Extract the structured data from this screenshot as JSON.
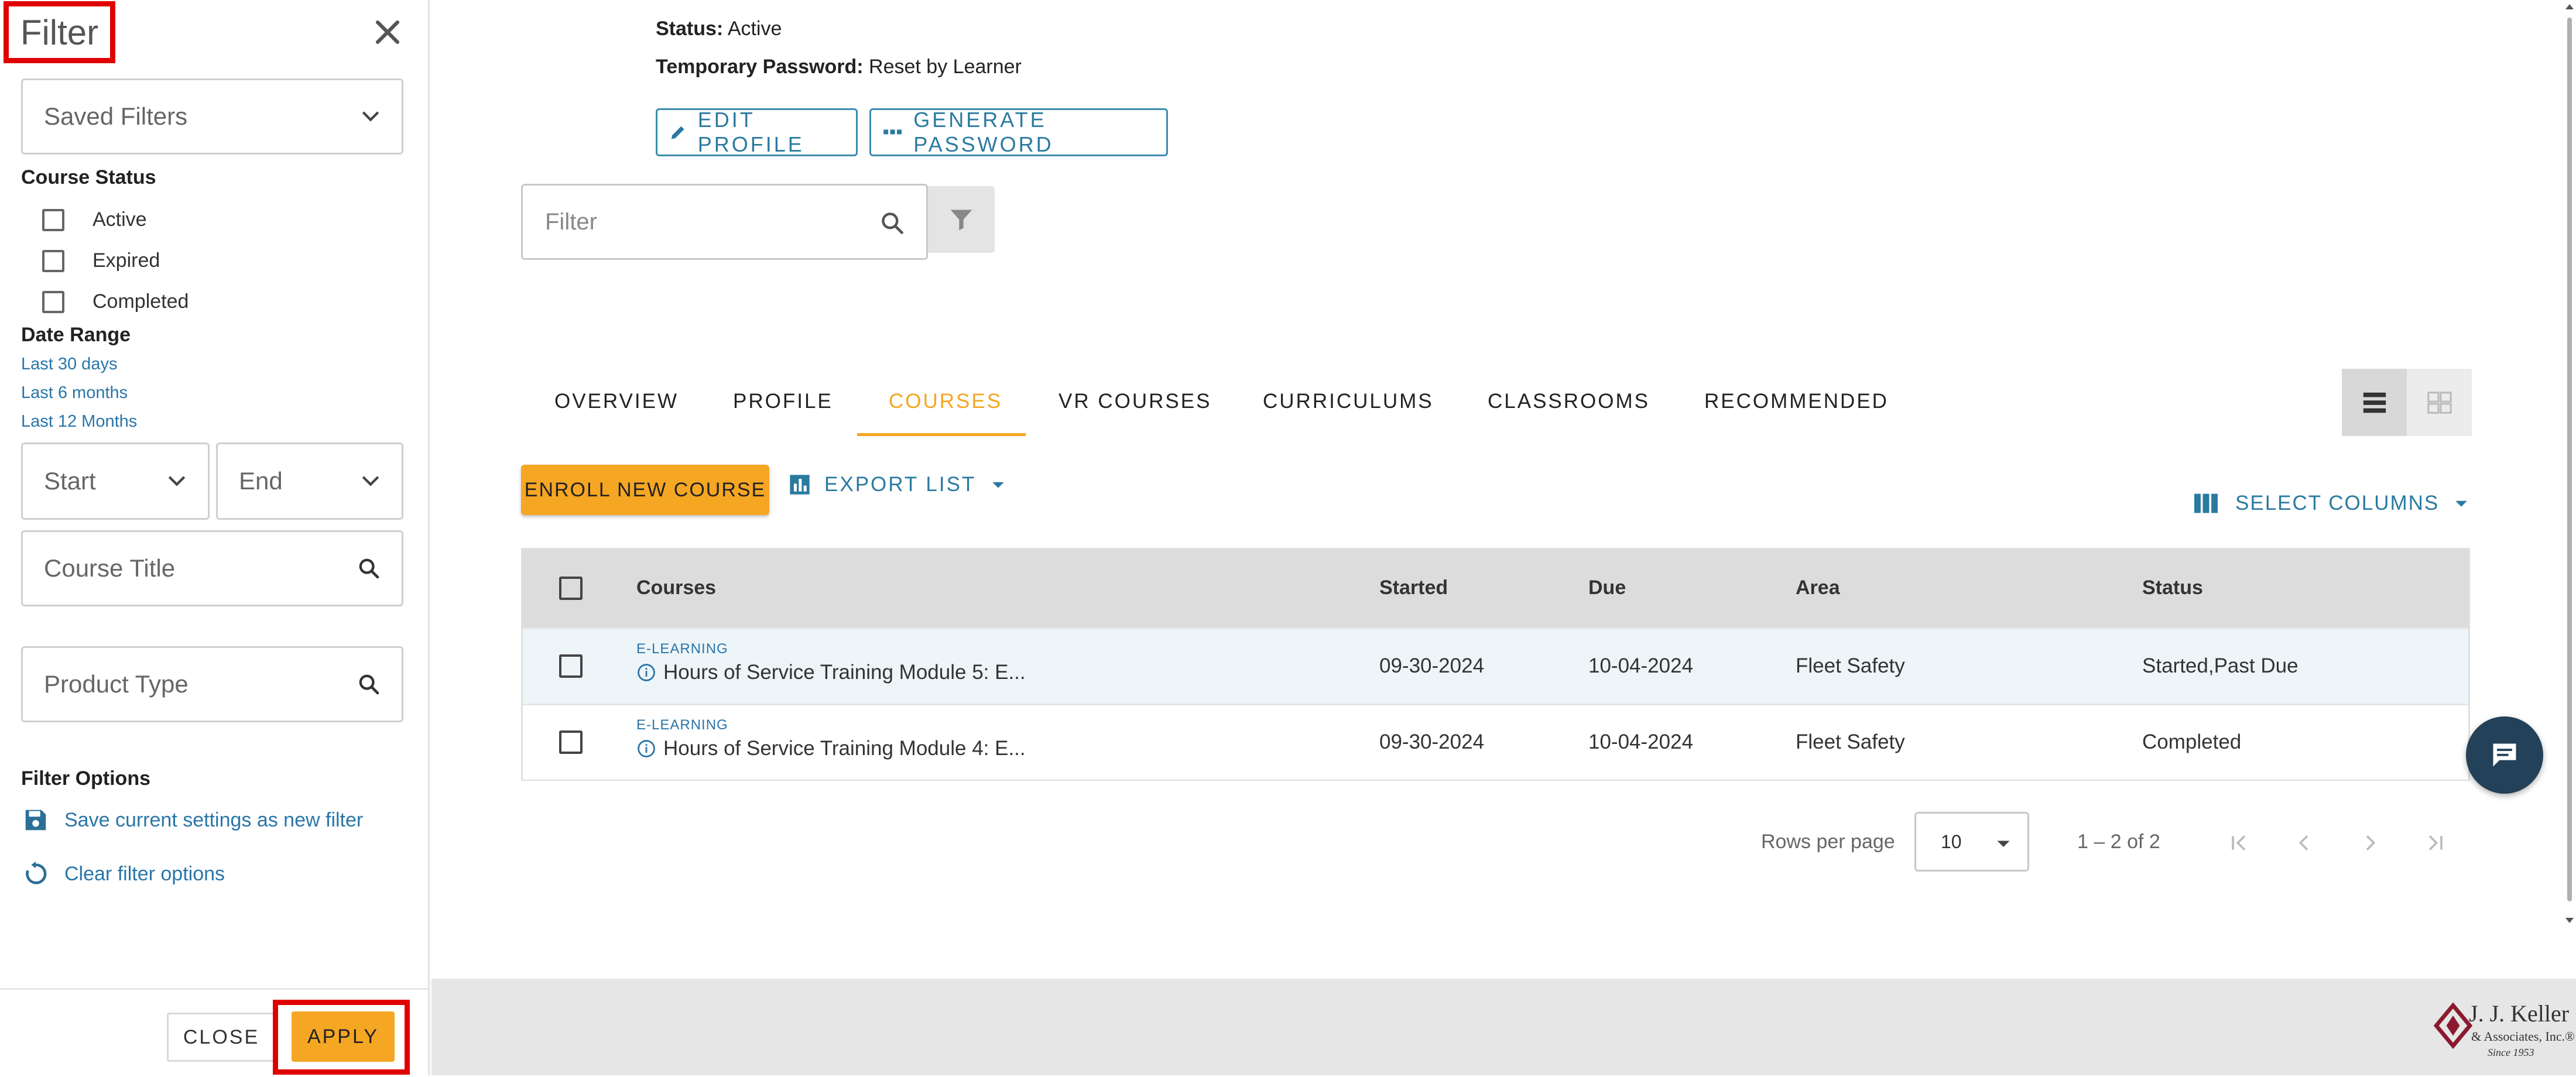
{
  "filter_panel": {
    "title": "Filter",
    "saved_filters_placeholder": "Saved Filters",
    "course_status_label": "Course Status",
    "statuses": [
      "Active",
      "Expired",
      "Completed"
    ],
    "date_range_label": "Date Range",
    "date_presets": [
      "Last 30 days",
      "Last 6 months",
      "Last 12 Months"
    ],
    "start_placeholder": "Start",
    "end_placeholder": "End",
    "course_title_placeholder": "Course Title",
    "product_type_placeholder": "Product Type",
    "filter_options_label": "Filter Options",
    "save_filter_label": "Save current settings as new filter",
    "clear_filter_label": "Clear filter options",
    "close_label": "CLOSE",
    "apply_label": "APPLY"
  },
  "profile": {
    "status_label": "Status:",
    "status_value": "Active",
    "temp_password_label": "Temporary Password:",
    "temp_password_value": "Reset by Learner",
    "edit_profile_label": "EDIT PROFILE",
    "generate_password_label": "GENERATE PASSWORD"
  },
  "search": {
    "placeholder": "Filter"
  },
  "tabs": [
    "OVERVIEW",
    "PROFILE",
    "COURSES",
    "VR COURSES",
    "CURRICULUMS",
    "CLASSROOMS",
    "RECOMMENDED"
  ],
  "active_tab": "COURSES",
  "toolbar": {
    "enroll_label": "ENROLL NEW COURSE",
    "export_label": "EXPORT LIST",
    "select_columns_label": "SELECT COLUMNS"
  },
  "table": {
    "columns": [
      "Courses",
      "Started",
      "Due",
      "Area",
      "Status"
    ],
    "rows": [
      {
        "type": "E-LEARNING",
        "title": "Hours of Service Training Module 5: E...",
        "started": "09-30-2024",
        "due": "10-04-2024",
        "area": "Fleet Safety",
        "status": "Started,Past Due"
      },
      {
        "type": "E-LEARNING",
        "title": "Hours of Service Training Module 4: E...",
        "started": "09-30-2024",
        "due": "10-04-2024",
        "area": "Fleet Safety",
        "status": "Completed"
      }
    ]
  },
  "pagination": {
    "rows_per_page_label": "Rows per page",
    "rows_per_page": "10",
    "range": "1 – 2 of 2"
  },
  "brand": {
    "name": "J. J. Keller",
    "sub": "& Associates, Inc.®",
    "since": "Since 1953"
  },
  "colors": {
    "accent": "#f5a623",
    "link": "#2a76a8",
    "highlight": "#e00000",
    "chat": "#234158"
  },
  "icons": [
    "close-icon",
    "chevron-down-icon",
    "search-icon",
    "save-icon",
    "refresh-icon",
    "pencil-icon",
    "dots-icon",
    "funnel-icon",
    "list-view-icon",
    "grid-view-icon",
    "bar-chart-icon",
    "columns-icon",
    "info-icon",
    "first-page-icon",
    "prev-page-icon",
    "next-page-icon",
    "last-page-icon",
    "chat-icon"
  ]
}
